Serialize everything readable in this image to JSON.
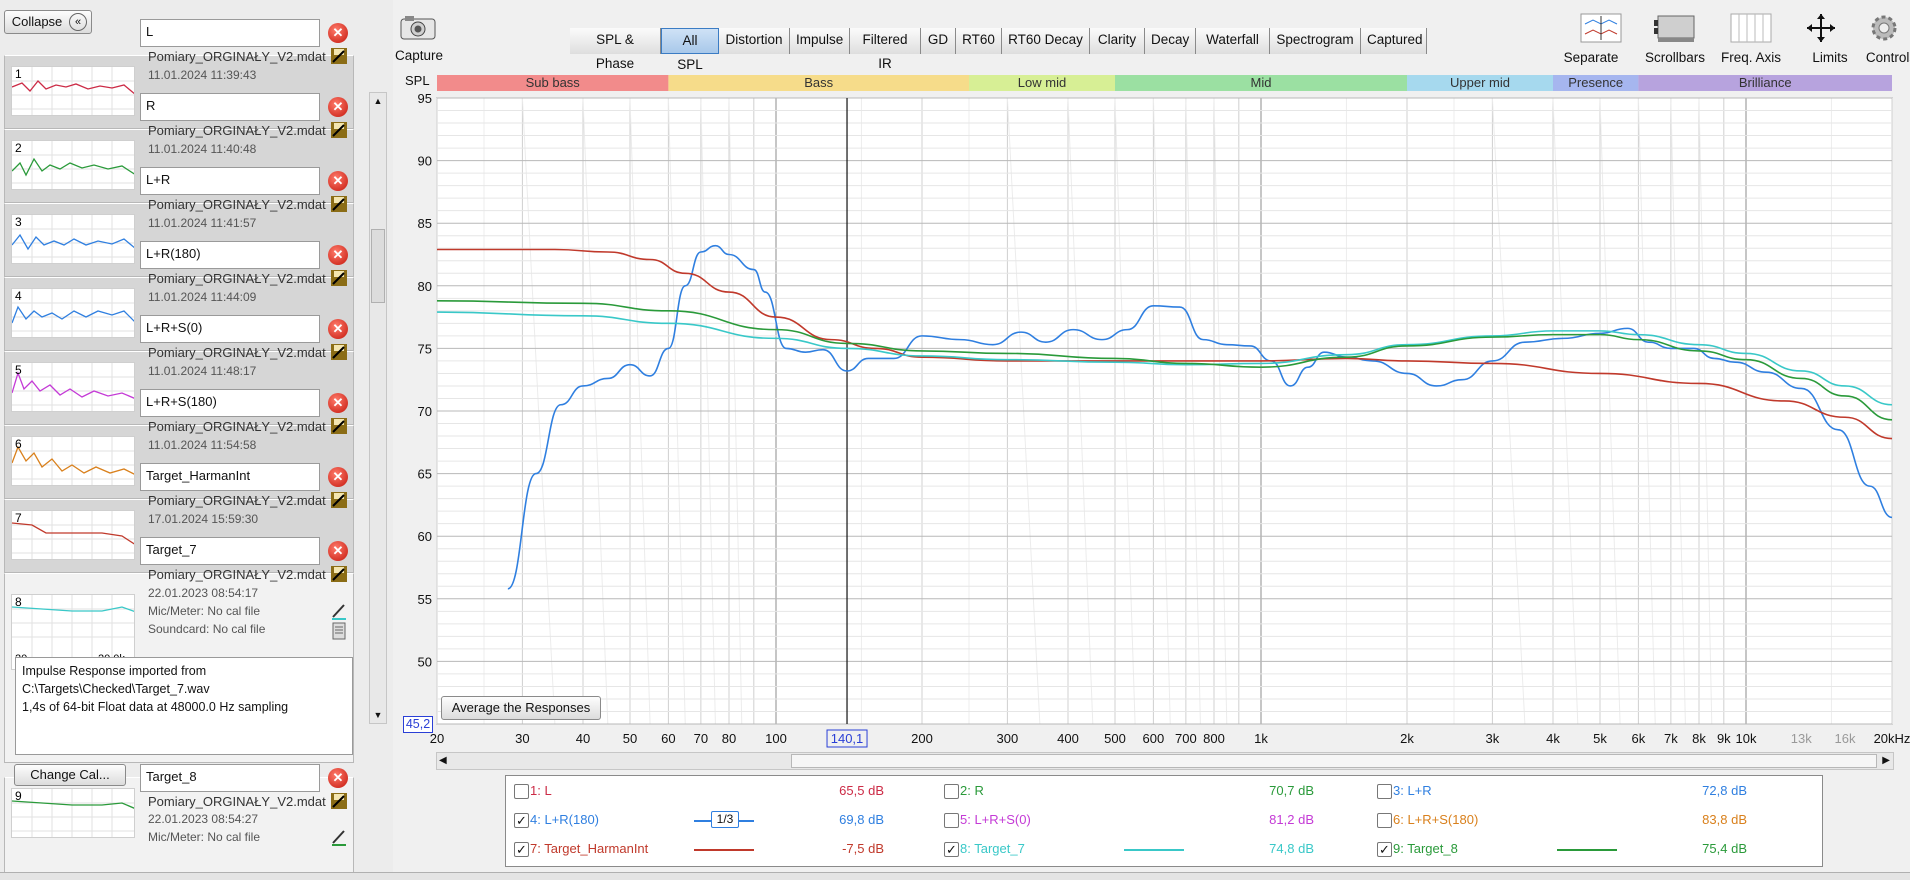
{
  "toolbar": {
    "collapse_label": "Collapse",
    "capture_label": "Capture",
    "tabs": [
      "SPL & Phase",
      "All SPL",
      "Distortion",
      "Impulse",
      "Filtered IR",
      "GD",
      "RT60",
      "RT60 Decay",
      "Clarity",
      "Decay",
      "Waterfall",
      "Spectrogram",
      "Captured"
    ],
    "selected_tab": "All SPL",
    "tools": [
      "Separate",
      "Scrollbars",
      "Freq. Axis",
      "Limits",
      "Controls"
    ]
  },
  "measurements": [
    {
      "num": "1",
      "name": "L",
      "file": "Pomiary_ORGINAŁY_V2.mdat",
      "date": "11.01.2024 11:39:43",
      "color": "#cc2b46"
    },
    {
      "num": "2",
      "name": "R",
      "file": "Pomiary_ORGINAŁY_V2.mdat",
      "date": "11.01.2024 11:40:48",
      "color": "#2a9a3a"
    },
    {
      "num": "3",
      "name": "L+R",
      "file": "Pomiary_ORGINAŁY_V2.mdat",
      "date": "11.01.2024 11:41:57",
      "color": "#2f7fe0"
    },
    {
      "num": "4",
      "name": "L+R(180)",
      "file": "Pomiary_ORGINAŁY_V2.mdat",
      "date": "11.01.2024 11:44:09",
      "color": "#2f7fe0"
    },
    {
      "num": "5",
      "name": "L+R+S(0)",
      "file": "Pomiary_ORGINAŁY_V2.mdat",
      "date": "11.01.2024 11:48:17",
      "color": "#c43ad6"
    },
    {
      "num": "6",
      "name": "L+R+S(180)",
      "file": "Pomiary_ORGINAŁY_V2.mdat",
      "date": "11.01.2024 11:54:58",
      "color": "#d9801c"
    },
    {
      "num": "7",
      "name": "Target_HarmanInt",
      "file": "Pomiary_ORGINAŁY_V2.mdat",
      "date": "17.01.2024 15:59:30",
      "color": "#c0392b"
    },
    {
      "num": "8",
      "name": "Target_7",
      "file": "Pomiary_ORGINAŁY_V2.mdat",
      "date": "22.01.2023 08:54:17",
      "color": "#39c8c8"
    },
    {
      "num": "9",
      "name": "Target_8",
      "file": "Pomiary_ORGINAŁY_V2.mdat",
      "date": "22.01.2023 08:54:27",
      "color": "#2a9a3a"
    }
  ],
  "expanded": {
    "thumb_min": "20",
    "thumb_max": "20,0k",
    "mic": "Mic/Meter: No cal file",
    "soundcard": "Soundcard: No cal file",
    "info_lines": [
      "Impulse Response imported from",
      "C:\\Targets\\Checked\\Target_7.wav",
      "1,4s of 64-bit Float data at 48000.0 Hz sampling"
    ],
    "change_cal": "Change Cal...",
    "mic9": "Mic/Meter: No cal file"
  },
  "bands": [
    {
      "label": "Sub bass",
      "color": "#f28b8b"
    },
    {
      "label": "Bass",
      "color": "#f6dc8a"
    },
    {
      "label": "Low mid",
      "color": "#d7ef95"
    },
    {
      "label": "Mid",
      "color": "#9be0a2"
    },
    {
      "label": "Upper mid",
      "color": "#a6d9ee"
    },
    {
      "label": "Presence",
      "color": "#a6b6ef"
    },
    {
      "label": "Brilliance",
      "color": "#b7a3de"
    }
  ],
  "cursor": {
    "freq": "140,1",
    "spl": "45,2"
  },
  "avg_button": "Average the Responses",
  "legend": [
    {
      "label": "1: L",
      "value": "65,5 dB",
      "checked": false,
      "color": "#cc2b46"
    },
    {
      "label": "2: R",
      "value": "70,7 dB",
      "checked": false,
      "color": "#2a9a3a"
    },
    {
      "label": "3: L+R",
      "value": "72,8 dB",
      "checked": false,
      "color": "#2f7fe0"
    },
    {
      "label": "4: L+R(180)",
      "value": "69,8 dB",
      "checked": true,
      "color": "#2f7fe0",
      "smoothing": "1/3"
    },
    {
      "label": "5: L+R+S(0)",
      "value": "81,2 dB",
      "checked": false,
      "color": "#c43ad6"
    },
    {
      "label": "6: L+R+S(180)",
      "value": "83,8 dB",
      "checked": false,
      "color": "#d9801c"
    },
    {
      "label": "7: Target_HarmanInt",
      "value": "-7,5 dB",
      "checked": true,
      "color": "#c0392b"
    },
    {
      "label": "8: Target_7",
      "value": "74,8 dB",
      "checked": true,
      "color": "#39c8c8"
    },
    {
      "label": "9: Target_8",
      "value": "75,4 dB",
      "checked": true,
      "color": "#2a9a3a"
    }
  ],
  "chart_data": {
    "type": "line",
    "ylabel": "SPL",
    "xscale": "log",
    "xlim": [
      20,
      20000
    ],
    "ylim": [
      45,
      95
    ],
    "yticks": [
      "95",
      "90",
      "85",
      "80",
      "75",
      "70",
      "65",
      "60",
      "55",
      "50"
    ],
    "xticks": [
      "20",
      "30",
      "40",
      "50",
      "60",
      "70",
      "80",
      "100",
      "140,1",
      "200",
      "300",
      "400",
      "500",
      "600",
      "700",
      "800",
      "1k",
      "2k",
      "3k",
      "4k",
      "5k",
      "6k",
      "7k",
      "8k",
      "9k",
      "10k",
      "13k",
      "16k",
      "20kHz"
    ],
    "series": [
      {
        "name": "4: L+R(180)",
        "color": "#2f7fe0",
        "points": [
          [
            28,
            55.8
          ],
          [
            32,
            65
          ],
          [
            36,
            70.5
          ],
          [
            40,
            72
          ],
          [
            45,
            72.6
          ],
          [
            50,
            73.7
          ],
          [
            55,
            72.8
          ],
          [
            60,
            75
          ],
          [
            65,
            80
          ],
          [
            70,
            82.7
          ],
          [
            75,
            83.2
          ],
          [
            80,
            82.5
          ],
          [
            90,
            81.3
          ],
          [
            95,
            79.5
          ],
          [
            105,
            75
          ],
          [
            115,
            74.7
          ],
          [
            125,
            74.9
          ],
          [
            140,
            73.2
          ],
          [
            155,
            74.2
          ],
          [
            175,
            74.2
          ],
          [
            200,
            76
          ],
          [
            240,
            75.7
          ],
          [
            280,
            75.3
          ],
          [
            320,
            76.3
          ],
          [
            360,
            75.5
          ],
          [
            410,
            76.5
          ],
          [
            470,
            75.7
          ],
          [
            530,
            76.5
          ],
          [
            600,
            78.4
          ],
          [
            680,
            78.3
          ],
          [
            760,
            75.7
          ],
          [
            850,
            75.3
          ],
          [
            950,
            75.2
          ],
          [
            1050,
            74
          ],
          [
            1150,
            72
          ],
          [
            1250,
            73.5
          ],
          [
            1350,
            74.7
          ],
          [
            1500,
            74.3
          ],
          [
            1700,
            74
          ],
          [
            2000,
            73
          ],
          [
            2300,
            72
          ],
          [
            2600,
            72.5
          ],
          [
            3000,
            74
          ],
          [
            3500,
            75.5
          ],
          [
            4200,
            75.8
          ],
          [
            5000,
            76.2
          ],
          [
            5700,
            76.6
          ],
          [
            6300,
            75.5
          ],
          [
            7000,
            75
          ],
          [
            7800,
            75
          ],
          [
            8600,
            74.2
          ],
          [
            9500,
            73.9
          ],
          [
            11000,
            73.1
          ],
          [
            13000,
            71.8
          ],
          [
            15500,
            68.5
          ],
          [
            18000,
            64
          ],
          [
            20000,
            61.5
          ]
        ]
      },
      {
        "name": "7: Target_HarmanInt",
        "color": "#c0392b",
        "points": [
          [
            20,
            82.9
          ],
          [
            35,
            82.9
          ],
          [
            45,
            82.7
          ],
          [
            55,
            82.1
          ],
          [
            65,
            81
          ],
          [
            80,
            79.5
          ],
          [
            100,
            77.5
          ],
          [
            130,
            75.7
          ],
          [
            160,
            75
          ],
          [
            200,
            74.3
          ],
          [
            300,
            74
          ],
          [
            500,
            74
          ],
          [
            1000,
            74
          ],
          [
            1500,
            74.2
          ],
          [
            2000,
            74
          ],
          [
            3000,
            73.8
          ],
          [
            5000,
            73
          ],
          [
            8000,
            72.2
          ],
          [
            12000,
            70.8
          ],
          [
            16000,
            69.5
          ],
          [
            20000,
            67.8
          ]
        ]
      },
      {
        "name": "8: Target_7",
        "color": "#39c8c8",
        "points": [
          [
            20,
            77.9
          ],
          [
            40,
            77.6
          ],
          [
            60,
            77
          ],
          [
            100,
            75.8
          ],
          [
            140,
            75
          ],
          [
            200,
            74.4
          ],
          [
            300,
            74.1
          ],
          [
            500,
            73.9
          ],
          [
            700,
            73.7
          ],
          [
            1000,
            73.8
          ],
          [
            1500,
            74.5
          ],
          [
            2000,
            75.3
          ],
          [
            3000,
            76
          ],
          [
            4000,
            76.4
          ],
          [
            5000,
            76.4
          ],
          [
            6000,
            76.1
          ],
          [
            8000,
            75.3
          ],
          [
            10000,
            74.6
          ],
          [
            13000,
            73.2
          ],
          [
            16000,
            72
          ],
          [
            20000,
            70.5
          ]
        ]
      },
      {
        "name": "9: Target_8",
        "color": "#2a9a3a",
        "points": [
          [
            20,
            78.8
          ],
          [
            40,
            78.6
          ],
          [
            60,
            78
          ],
          [
            100,
            76.5
          ],
          [
            140,
            75.4
          ],
          [
            200,
            74.8
          ],
          [
            300,
            74.6
          ],
          [
            500,
            74.2
          ],
          [
            700,
            73.8
          ],
          [
            1000,
            73.5
          ],
          [
            1500,
            74.3
          ],
          [
            2000,
            75.2
          ],
          [
            3000,
            75.9
          ],
          [
            4000,
            76.1
          ],
          [
            5000,
            76.1
          ],
          [
            6000,
            75.7
          ],
          [
            8000,
            74.8
          ],
          [
            10000,
            74.1
          ],
          [
            13000,
            72.6
          ],
          [
            16000,
            71.2
          ],
          [
            20000,
            69.3
          ]
        ]
      }
    ]
  }
}
